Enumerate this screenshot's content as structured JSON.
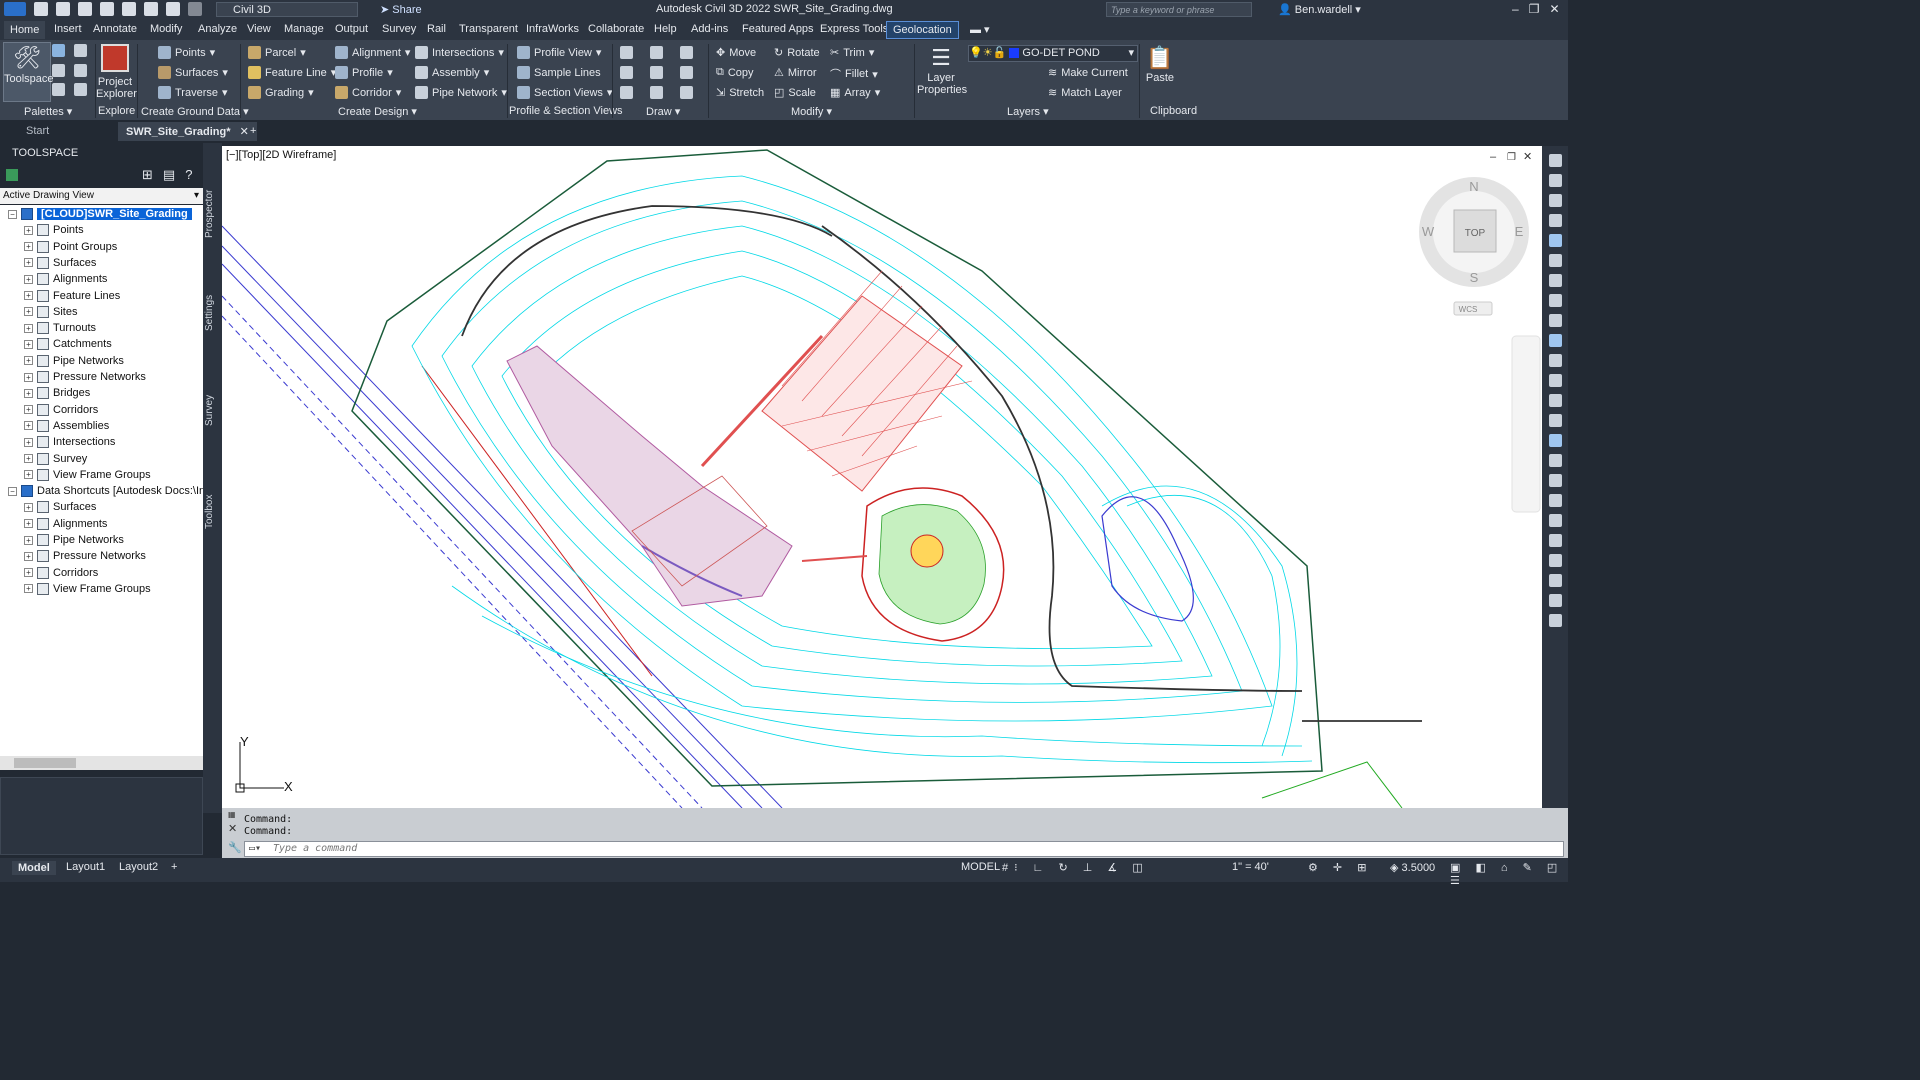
{
  "title_bar": {
    "app_title": "Autodesk Civil 3D 2022   SWR_Site_Grading.dwg",
    "workspace": "Civil 3D",
    "share": "Share",
    "search_placeholder": "Type a keyword or phrase",
    "user": "Ben.wardell"
  },
  "menu_tabs": [
    "Home",
    "Insert",
    "Annotate",
    "Modify",
    "Analyze",
    "View",
    "Manage",
    "Output",
    "Survey",
    "Rail",
    "Transparent",
    "InfraWorks",
    "Collaborate",
    "Help",
    "Add-ins",
    "Featured Apps",
    "Express Tools",
    "Geolocation"
  ],
  "ribbon": {
    "palettes": {
      "toolspace": "Toolspace",
      "title": "Palettes"
    },
    "explore": {
      "project_explorer": "Project Explorer",
      "title": "Explore"
    },
    "create_ground_data": {
      "points": "Points",
      "surfaces": "Surfaces",
      "traverse": "Traverse",
      "title": "Create Ground Data"
    },
    "create_design": {
      "parcel": "Parcel",
      "feature_line": "Feature Line",
      "grading": "Grading",
      "alignment": "Alignment",
      "profile": "Profile",
      "corridor": "Corridor",
      "intersections": "Intersections",
      "assembly": "Assembly",
      "pipe_network": "Pipe Network",
      "title": "Create Design"
    },
    "profile_section": {
      "profile_view": "Profile View",
      "sample_lines": "Sample Lines",
      "section_views": "Section Views",
      "title": "Profile & Section Views"
    },
    "draw": {
      "title": "Draw"
    },
    "modify": {
      "move": "Move",
      "copy": "Copy",
      "stretch": "Stretch",
      "rotate": "Rotate",
      "mirror": "Mirror",
      "scale": "Scale",
      "trim": "Trim",
      "fillet": "Fillet",
      "array": "Array",
      "title": "Modify"
    },
    "layers": {
      "layer_properties": "Layer Properties",
      "current_layer": "GO-DET POND",
      "make_current": "Make Current",
      "match_layer": "Match Layer",
      "title": "Layers"
    },
    "clipboard": {
      "paste": "Paste",
      "title": "Clipboard"
    }
  },
  "doc_tabs": {
    "start": "Start",
    "active": "SWR_Site_Grading*"
  },
  "toolspace": {
    "header": "TOOLSPACE",
    "view_selector": "Active Drawing View",
    "side_tabs": [
      "Prospector",
      "Settings",
      "Survey",
      "Toolbox"
    ],
    "tree": [
      {
        "label": "[CLOUD]SWR_Site_Grading",
        "level": 0,
        "selected": true
      },
      {
        "label": "Points",
        "level": 1
      },
      {
        "label": "Point Groups",
        "level": 1
      },
      {
        "label": "Surfaces",
        "level": 1
      },
      {
        "label": "Alignments",
        "level": 1
      },
      {
        "label": "Feature Lines",
        "level": 1
      },
      {
        "label": "Sites",
        "level": 1
      },
      {
        "label": "Turnouts",
        "level": 1
      },
      {
        "label": "Catchments",
        "level": 1
      },
      {
        "label": "Pipe Networks",
        "level": 1
      },
      {
        "label": "Pressure Networks",
        "level": 1
      },
      {
        "label": "Bridges",
        "level": 1
      },
      {
        "label": "Corridors",
        "level": 1
      },
      {
        "label": "Assemblies",
        "level": 1
      },
      {
        "label": "Intersections",
        "level": 1
      },
      {
        "label": "Survey",
        "level": 1
      },
      {
        "label": "View Frame Groups",
        "level": 1
      },
      {
        "label": "Data Shortcuts [Autodesk Docs:\\Infr...",
        "level": 0
      },
      {
        "label": "Surfaces",
        "level": 1
      },
      {
        "label": "Alignments",
        "level": 1
      },
      {
        "label": "Pipe Networks",
        "level": 1
      },
      {
        "label": "Pressure Networks",
        "level": 1
      },
      {
        "label": "Corridors",
        "level": 1
      },
      {
        "label": "View Frame Groups",
        "level": 1
      }
    ]
  },
  "viewport": {
    "label": "[−][Top][2D Wireframe]",
    "viewcube": {
      "n": "N",
      "s": "S",
      "e": "E",
      "w": "W",
      "top": "TOP",
      "wcs": "WCS"
    },
    "ucs": {
      "x": "X",
      "y": "Y"
    }
  },
  "command": {
    "history": [
      "Command:",
      "Command:"
    ],
    "placeholder": "Type a command"
  },
  "status_bar": {
    "layouts": [
      "Model",
      "Layout1",
      "Layout2"
    ],
    "model": "MODEL",
    "scale": "1\" = 40'",
    "value": "3.5000"
  },
  "colors": {
    "contour": "#00e5ee",
    "boundary": "#1a5c3a",
    "road": "#3a3ad0",
    "grid": "#e05050",
    "accent": "#0a64d8"
  }
}
